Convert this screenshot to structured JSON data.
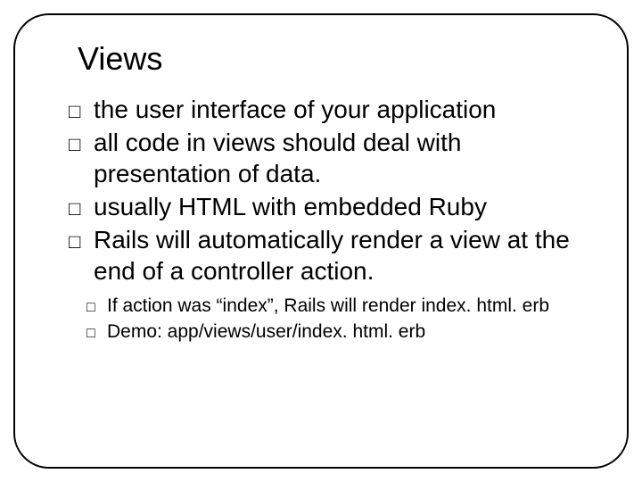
{
  "title": "Views",
  "bullets": [
    "the user interface of your application",
    "all code in views should deal with presentation of data.",
    "usually HTML with embedded Ruby",
    "Rails will automatically render a view at the end of a controller action."
  ],
  "sub_bullets": [
    "If action was “index”, Rails will render index. html. erb",
    "Demo: app/views/user/index. html. erb"
  ]
}
